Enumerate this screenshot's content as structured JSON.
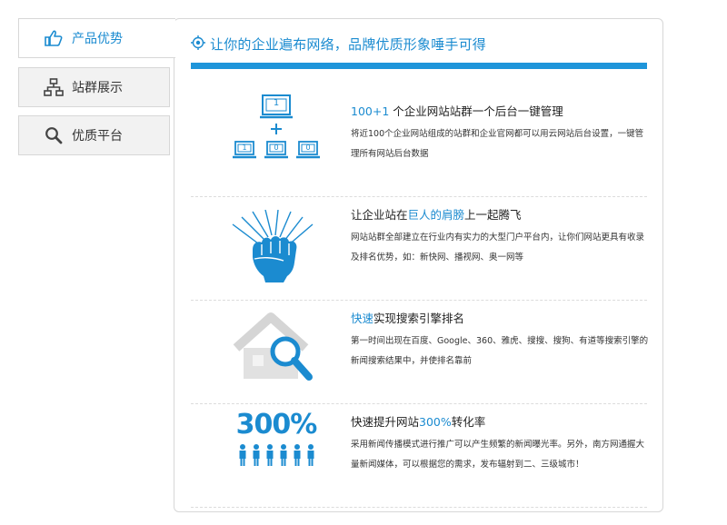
{
  "sidebar": {
    "items": [
      {
        "label": "产品优势",
        "icon": "thumbs-up-icon",
        "active": true
      },
      {
        "label": "站群展示",
        "icon": "sitemap-icon",
        "active": false
      },
      {
        "label": "优质平台",
        "icon": "search-icon",
        "active": false
      }
    ]
  },
  "panel": {
    "title": "让你的企业遍布网络，品牌优质形象唾手可得",
    "icon": "target-icon"
  },
  "features": [
    {
      "title_parts": [
        {
          "text": "100+1",
          "highlight": true
        },
        {
          "text": " 个企业网站站群一个后台一键管理",
          "highlight": false
        }
      ],
      "desc": "将近100个企业网站组成的站群和企业官网都可以用云网站后台设置，一键管理所有网站后台数据",
      "art": {
        "top_monitor": "1",
        "bottom_monitors": [
          "1",
          "0",
          "0"
        ],
        "plus": "+"
      }
    },
    {
      "title_parts": [
        {
          "text": "让企业站在",
          "highlight": false
        },
        {
          "text": "巨人的肩膀",
          "highlight": true
        },
        {
          "text": "上一起腾飞",
          "highlight": false
        }
      ],
      "desc": "网站站群全部建立在行业内有实力的大型门户平台内，让你们网站更具有收录及排名优势，如：新快网、播视网、奥一网等"
    },
    {
      "title_parts": [
        {
          "text": "快速",
          "highlight": true
        },
        {
          "text": "实现搜索引擎排名",
          "highlight": false
        }
      ],
      "desc": "第一时间出现在百度、Google、360、雅虎、搜搜、搜狗、有道等搜索引擎的新闻搜索结果中，并使排名靠前"
    },
    {
      "title_parts": [
        {
          "text": "快速提升网站",
          "highlight": false
        },
        {
          "text": "300%",
          "highlight": true
        },
        {
          "text": "转化率",
          "highlight": false
        }
      ],
      "desc": "采用新闻传播模式进行推广可以产生频繁的新闻曝光率。另外，南方网通握大量新闻媒体，可以根据您的需求，发布辐射到二、三级城市！",
      "art": {
        "big_text": "300%"
      }
    }
  ],
  "colors": {
    "accent": "#1b8bd0",
    "bar": "#1e95da",
    "border": "#d7d7d7",
    "tab_bg": "#f2f2f2"
  }
}
